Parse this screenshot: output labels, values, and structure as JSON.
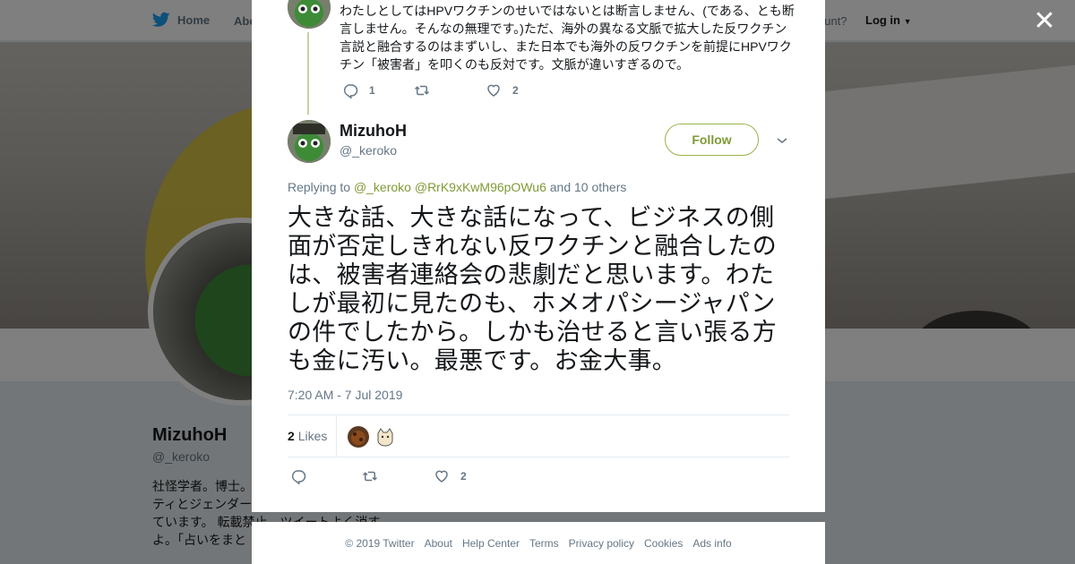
{
  "topbar": {
    "home_label": "Home",
    "about_label": "Abo",
    "account_prompt": "ccount?",
    "login_label": "Log in"
  },
  "profile": {
    "name": "MizuhoH",
    "handle": "@_keroko",
    "bio_lines": [
      "社怪学者。博士。",
      "ティとジェンダー",
      "ています。 転載禁止。ツイートよく消す",
      "よ。「占いをまと"
    ]
  },
  "thread_prev": {
    "text": "わたしとしてはHPVワクチンのせいではないとは断言しません、(である、とも断言しません。そんなの無理です。)ただ、海外の異なる文脈で拡大した反ワクチン言説と融合するのはまずいし、また日本でも海外の反ワクチンを前提にHPVワクチン「被害者」を叩くのも反対です。文脈が違いすぎるので。",
    "reply_count": "1",
    "like_count": "2"
  },
  "tweet": {
    "author_name": "MizuhoH",
    "author_handle": "@_keroko",
    "follow_label": "Follow",
    "replying_prefix": "Replying to",
    "replying_user1": "@_keroko",
    "replying_user2": "@RrK9xKwM96pOWu6",
    "replying_suffix": "and 10 others",
    "text": "大きな話、大きな話になって、ビジネスの側面が否定しきれない反ワクチンと融合したのは、被害者連絡会の悲劇だと思います。わたしが最初に見たのも、ホメオパシージャパンの件でしたから。しかも治せると言い張る方も金に汚い。最悪です。お金大事。",
    "timestamp": "7:20 AM - 7 Jul 2019",
    "likes_number": "2",
    "likes_label": "Likes",
    "like_count": "2"
  },
  "footer": {
    "copyright": "© 2019 Twitter",
    "links": [
      "About",
      "Help Center",
      "Terms",
      "Privacy policy",
      "Cookies",
      "Ads info"
    ]
  },
  "colors": {
    "accent": "#7f9a35",
    "thread_line": "#c5d2a1",
    "muted_text": "#657786"
  },
  "icons": [
    "twitter-bird-icon",
    "close-icon",
    "reply-icon",
    "retweet-icon",
    "heart-icon",
    "chevron-down-icon",
    "caret-down-icon"
  ]
}
